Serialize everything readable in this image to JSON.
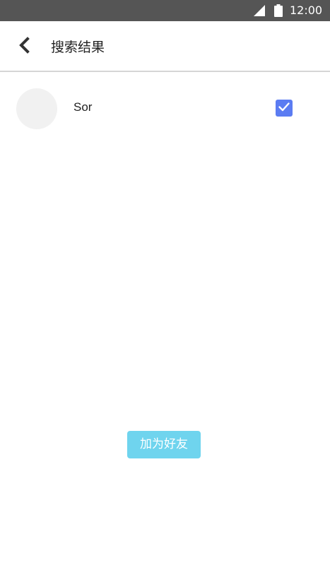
{
  "status_bar": {
    "time": "12:00",
    "signal_icon": "signal-icon",
    "battery_icon": "battery-icon"
  },
  "app_bar": {
    "back_icon": "chevron-left-icon",
    "title": "搜索结果"
  },
  "results": [
    {
      "name": "Sor",
      "checked": true
    }
  ],
  "actions": {
    "add_friend_label": "加为好友"
  },
  "colors": {
    "status_bar_bg": "#555555",
    "checkbox_checked": "#5b7cf2",
    "primary_button": "#6fd4ee",
    "avatar_placeholder": "#f1f1f1"
  }
}
